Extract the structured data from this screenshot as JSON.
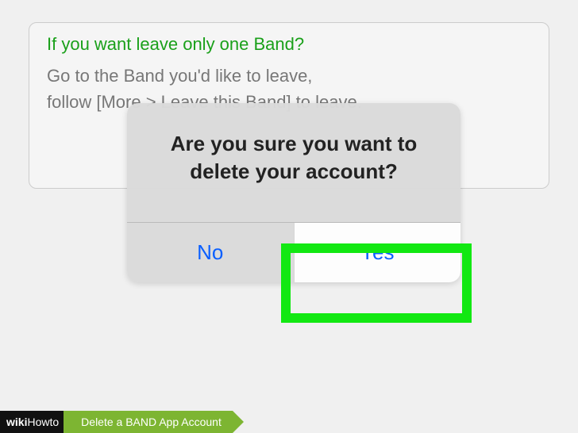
{
  "background": {
    "heading": "If you want leave only one Band?",
    "instructions": "Go to the Band you'd like to leave,\nfollow [More > Leave this Band] to leave."
  },
  "dialog": {
    "title": "Are you sure you want to delete your account?",
    "no_label": "No",
    "yes_label": "Yes"
  },
  "caption": {
    "brand_bold": "wiki",
    "brand_normal": "How",
    "article_prefix": " to ",
    "article_title": "Delete a BAND App Account"
  }
}
